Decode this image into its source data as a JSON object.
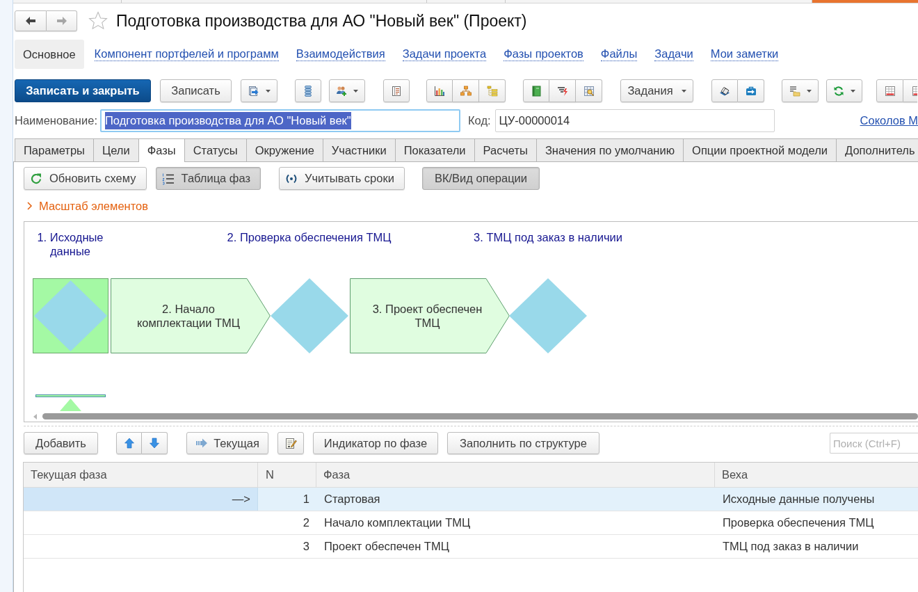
{
  "window": {
    "title": "Подготовка производства для АО \"Новый век\" (Проект)",
    "favorite": false
  },
  "sections": [
    {
      "label": "Основное",
      "selected": true
    },
    {
      "label": "Компонент портфелей и программ",
      "selected": false
    },
    {
      "label": "Взаимодействия",
      "selected": false
    },
    {
      "label": "Задачи проекта",
      "selected": false
    },
    {
      "label": "Фазы проектов",
      "selected": false
    },
    {
      "label": "Файлы",
      "selected": false
    },
    {
      "label": "Задачи",
      "selected": false
    },
    {
      "label": "Мои заметки",
      "selected": false
    }
  ],
  "toolbar": {
    "save_and_close": "Записать и закрыть",
    "save": "Записать",
    "tasks_menu": "Задания"
  },
  "fields": {
    "name": {
      "label": "Наименование:",
      "value": "Подготовка производства для АО \"Новый век\"",
      "focused": true
    },
    "code": {
      "label": "Код:",
      "value": "ЦУ-00000014"
    },
    "person_link": "Соколов М"
  },
  "tabs": [
    {
      "label": "Параметры",
      "selected": false
    },
    {
      "label": "Цели",
      "selected": false
    },
    {
      "label": "Фазы",
      "selected": true
    },
    {
      "label": "Статусы",
      "selected": false
    },
    {
      "label": "Окружение",
      "selected": false
    },
    {
      "label": "Участники",
      "selected": false
    },
    {
      "label": "Показатели",
      "selected": false
    },
    {
      "label": "Расчеты",
      "selected": false
    },
    {
      "label": "Значения по умолчанию",
      "selected": false
    },
    {
      "label": "Опции проектной модели",
      "selected": false
    },
    {
      "label": "Дополнитель",
      "selected": false
    }
  ],
  "phase_tools": [
    {
      "label": "Обновить схему",
      "pressed": false
    },
    {
      "label": "Таблица фаз",
      "pressed": true
    },
    {
      "label": "Учитывать сроки",
      "pressed": false
    },
    {
      "label": "ВК/Вид операции",
      "pressed": true
    }
  ],
  "scale_group": {
    "label": "Масштаб элементов",
    "expanded": false
  },
  "diagram": {
    "milestones": [
      {
        "label": "1. Исходные данные"
      },
      {
        "label": "2. Проверка обеспечения ТМЦ"
      },
      {
        "label": "3. ТМЦ под заказ в наличии"
      }
    ],
    "phases": [
      {
        "kind": "start",
        "current": true
      },
      {
        "kind": "step",
        "label": "2. Начало комплектации ТМЦ",
        "current": false
      },
      {
        "kind": "step",
        "label": "3. Проект обеспечен ТМЦ",
        "current": false
      }
    ]
  },
  "table_toolbar": {
    "add": "Добавить",
    "current": "Текущая",
    "phase_indicator": "Индикатор по фазе",
    "fill_by_structure": "Заполнить по структуре",
    "search": {
      "placeholder": "Поиск (Ctrl+F)"
    }
  },
  "table": {
    "columns": [
      "Текущая фаза",
      "N",
      "Фаза",
      "Веха"
    ],
    "rows": [
      {
        "current_phase": "—>",
        "n": "1",
        "phase": "Стартовая",
        "milestone": "Исходные данные получены",
        "selected": true
      },
      {
        "n": "2",
        "phase": "Начало комплектации ТМЦ",
        "milestone": "Проверка обеспечения ТМЦ",
        "selected": false
      },
      {
        "n": "3",
        "phase": "Проект обеспечен ТМЦ",
        "milestone": "ТМЦ под заказ в наличии",
        "selected": false
      }
    ]
  }
}
